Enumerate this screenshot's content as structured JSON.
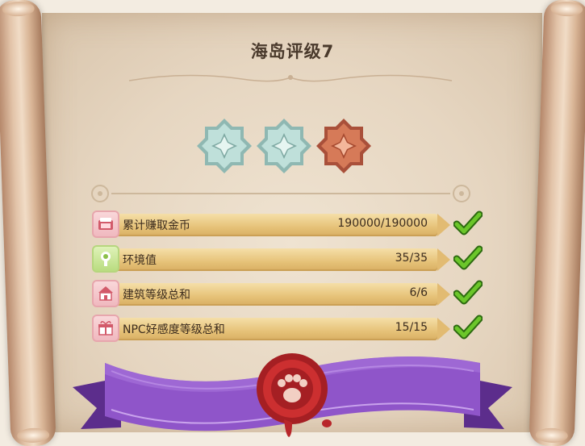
{
  "panel": {
    "title": "海岛评级7"
  },
  "rating": {
    "stars": [
      {
        "state": "earned",
        "color": "#a8cfc8"
      },
      {
        "state": "earned",
        "color": "#a8cfc8"
      },
      {
        "state": "earned",
        "color": "#c8694a"
      }
    ]
  },
  "requirements": [
    {
      "icon": "coin-shop-icon",
      "label": "累计赚取金币",
      "value": "190000/190000",
      "completed": true
    },
    {
      "icon": "environment-tree-icon",
      "label": "环境值",
      "value": "35/35",
      "completed": true
    },
    {
      "icon": "building-house-icon",
      "label": "建筑等级总和",
      "value": "6/6",
      "completed": true
    },
    {
      "icon": "gift-box-icon",
      "label": "NPC好感度等级总和",
      "value": "15/15",
      "completed": true
    }
  ],
  "colors": {
    "ribbon": "#8f55c9",
    "seal": "#c0282a",
    "check": "#5fb81e"
  }
}
